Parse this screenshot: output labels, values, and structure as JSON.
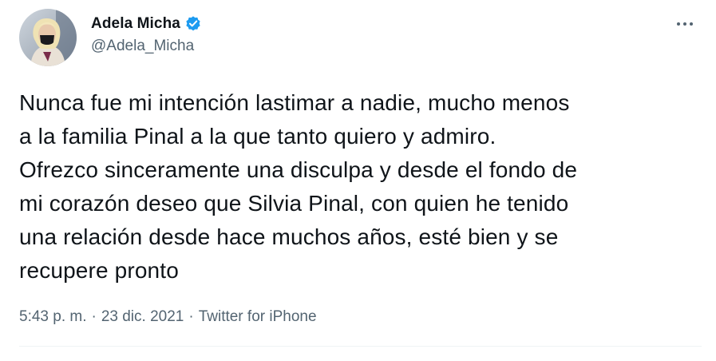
{
  "author": {
    "display_name": "Adela Micha",
    "handle": "@Adela_Micha",
    "verified": true
  },
  "tweet": {
    "text": "Nunca fue mi intención lastimar a nadie, mucho menos\na la familia Pinal a la que tanto quiero y admiro.\nOfrezco sinceramente una disculpa y desde el fondo de\nmi corazón deseo que Silvia Pinal, con quien he tenido\nuna relación desde hace muchos años, esté bien y se\nrecupere pronto",
    "time": "5:43 p. m.",
    "date": "23 dic. 2021",
    "source": "Twitter for iPhone",
    "separator": "·"
  },
  "icons": {
    "verified": "verified-badge-icon",
    "more": "more-horizontal-icon"
  },
  "colors": {
    "primary_text": "#0f1419",
    "secondary_text": "#536471",
    "verified_blue": "#1d9bf0",
    "divider": "#eff3f4"
  }
}
